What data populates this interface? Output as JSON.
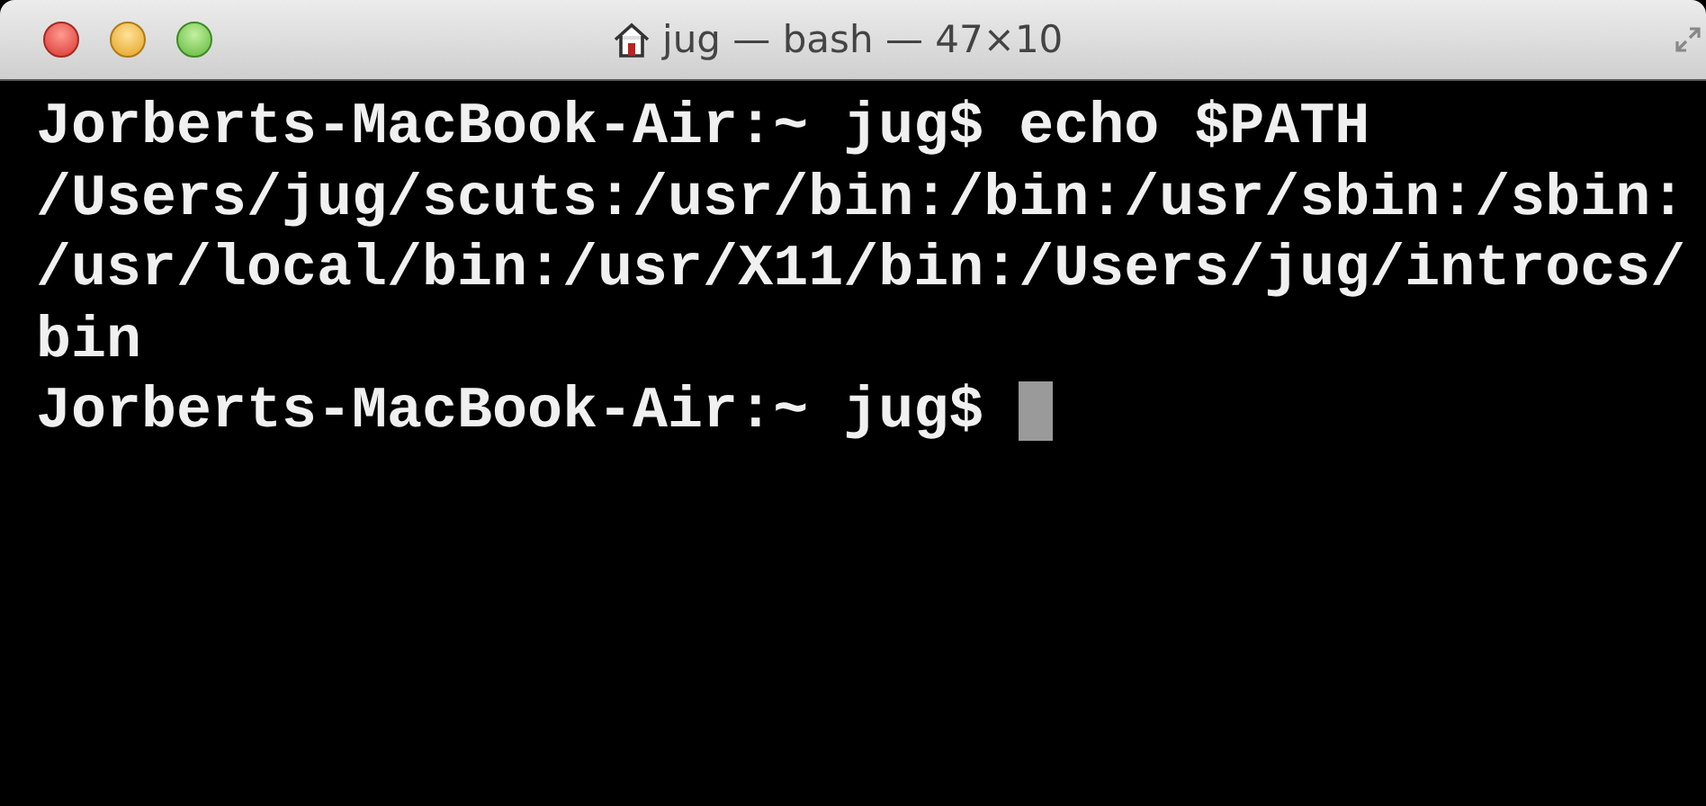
{
  "window": {
    "title": "jug — bash — 47×10"
  },
  "lines": [
    {
      "text": "Jorberts-MacBook-Air:~ jug$ echo $PATH",
      "cursor": false
    },
    {
      "text": "/Users/jug/scuts:/usr/bin:/bin:/usr/sbin:/sbin:",
      "cursor": false
    },
    {
      "text": "/usr/local/bin:/usr/X11/bin:/Users/jug/introcs/",
      "cursor": false
    },
    {
      "text": "bin",
      "cursor": false
    },
    {
      "text": "Jorberts-MacBook-Air:~ jug$ ",
      "cursor": true
    }
  ]
}
